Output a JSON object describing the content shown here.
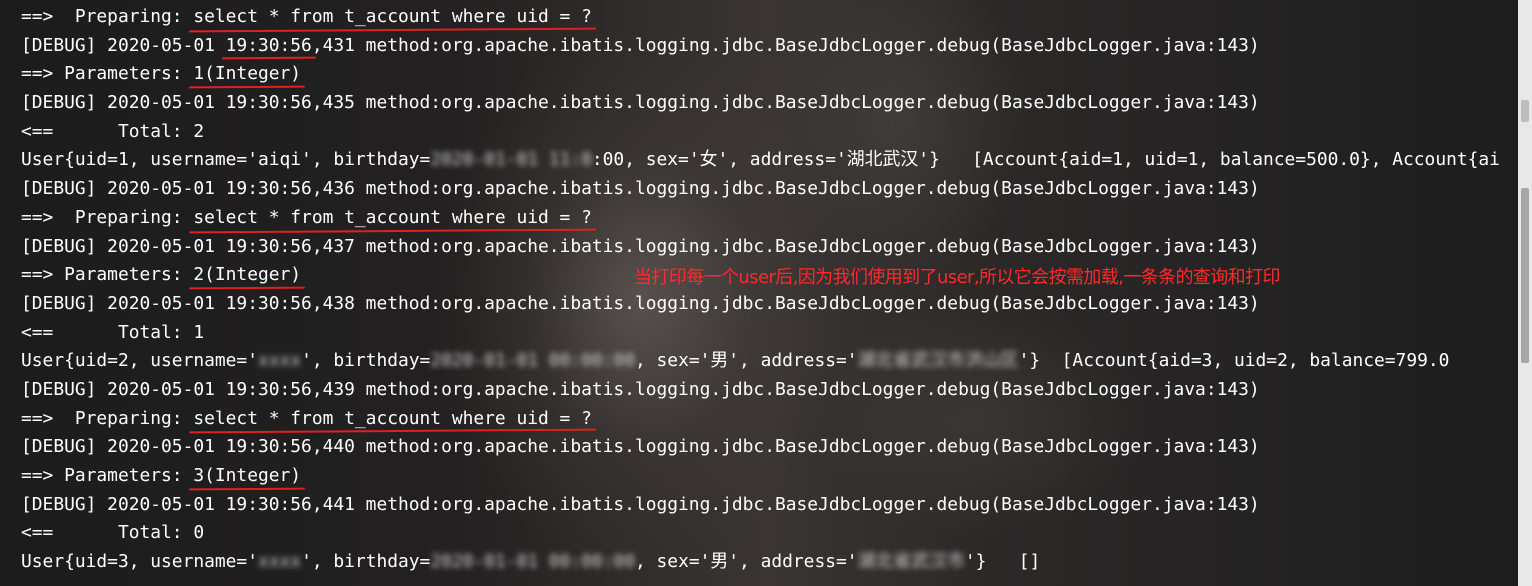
{
  "console": {
    "lines": [
      {
        "segments": [
          {
            "t": "==>  Preparing: "
          },
          {
            "t": "select * from t_account where uid = ?",
            "u": true
          }
        ]
      },
      {
        "segments": [
          {
            "t": "[DEBUG] 2020-05-01 "
          },
          {
            "t": "19:30:56",
            "u": true
          },
          {
            "t": ",431 method:org.apache.ibatis.logging.jdbc.BaseJdbcLogger.debug(BaseJdbcLogger.java:143)"
          }
        ]
      },
      {
        "segments": [
          {
            "t": "==> Parameters: "
          },
          {
            "t": "1(Integer)",
            "u": true
          }
        ]
      },
      {
        "segments": [
          {
            "t": "[DEBUG] 2020-05-01 19:30:56,435 method:org.apache.ibatis.logging.jdbc.BaseJdbcLogger.debug(BaseJdbcLogger.java:143)"
          }
        ]
      },
      {
        "segments": [
          {
            "t": "<==      Total: 2"
          }
        ]
      },
      {
        "segments": [
          {
            "t": "User{uid=1, username='aiqi', birthday="
          },
          {
            "t": "2020-01-01 11:0",
            "b": true
          },
          {
            "t": ":00, sex='女', address='湖北武汉'}   [Account{aid=1, uid=1, balance=500.0}, Account{ai"
          }
        ]
      },
      {
        "segments": [
          {
            "t": "[DEBUG] 2020-05-01 19:30:56,436 method:org.apache.ibatis.logging.jdbc.BaseJdbcLogger.debug(BaseJdbcLogger.java:143)"
          }
        ]
      },
      {
        "segments": [
          {
            "t": "==>  Preparing: "
          },
          {
            "t": "select * from t_account where uid = ?",
            "u": true
          }
        ]
      },
      {
        "segments": [
          {
            "t": "[DEBUG] 2020-05-01 19:30:56,437 method:org.apache.ibatis.logging.jdbc.BaseJdbcLogger.debug(BaseJdbcLogger.java:143)"
          }
        ]
      },
      {
        "segments": [
          {
            "t": "==> Parameters: "
          },
          {
            "t": "2(Integer)",
            "u": true
          }
        ]
      },
      {
        "segments": [
          {
            "t": "[DEBUG] 2020-05-01 19:30:56,438 method:org.apache.ibatis.logging.jdbc.BaseJdbcLogger.debug(BaseJdbcLogger.java:143)"
          }
        ]
      },
      {
        "segments": [
          {
            "t": "<==      Total: 1"
          }
        ]
      },
      {
        "segments": [
          {
            "t": "User{uid=2, username='"
          },
          {
            "t": "xxxx",
            "b": true
          },
          {
            "t": "', birthday="
          },
          {
            "t": "2020-01-01 00:00:00",
            "b": true
          },
          {
            "t": ", sex='男', address='"
          },
          {
            "t": "湖北省武汉市洪山区",
            "b": true
          },
          {
            "t": "'}  [Account{aid=3, uid=2, balance=799.0"
          }
        ]
      },
      {
        "segments": [
          {
            "t": "[DEBUG] 2020-05-01 19:30:56,439 method:org.apache.ibatis.logging.jdbc.BaseJdbcLogger.debug(BaseJdbcLogger.java:143)"
          }
        ]
      },
      {
        "segments": [
          {
            "t": "==>  Preparing: "
          },
          {
            "t": "select * from t_account where uid = ?",
            "u": true
          }
        ]
      },
      {
        "segments": [
          {
            "t": "[DEBUG] 2020-05-01 19:30:56,440 method:org.apache.ibatis.logging.jdbc.BaseJdbcLogger.debug(BaseJdbcLogger.java:143)"
          }
        ]
      },
      {
        "segments": [
          {
            "t": "==> Parameters: "
          },
          {
            "t": "3(Integer)",
            "u": true
          }
        ]
      },
      {
        "segments": [
          {
            "t": "[DEBUG] 2020-05-01 19:30:56,441 method:org.apache.ibatis.logging.jdbc.BaseJdbcLogger.debug(BaseJdbcLogger.java:143)"
          }
        ]
      },
      {
        "segments": [
          {
            "t": "<==      Total: 0"
          }
        ]
      },
      {
        "segments": [
          {
            "t": "User{uid=3, username='"
          },
          {
            "t": "xxxx",
            "b": true
          },
          {
            "t": "', birthday="
          },
          {
            "t": "2020-01-01 00:00:00",
            "b": true
          },
          {
            "t": ", sex='男', address='"
          },
          {
            "t": "湖北省武汉市",
            "b": true
          },
          {
            "t": "'}   []"
          }
        ]
      }
    ]
  },
  "annotation": {
    "text": "当打印每一个user后,因为我们使用到了user,所以它会按需加载,一条条的查询和打印",
    "color": "#ff2a2a"
  },
  "colors": {
    "text": "#ffffff",
    "underline": "#e02020",
    "scrollbar_track": "#e8e8e8",
    "scrollbar_thumb": "#a6a6a6"
  }
}
